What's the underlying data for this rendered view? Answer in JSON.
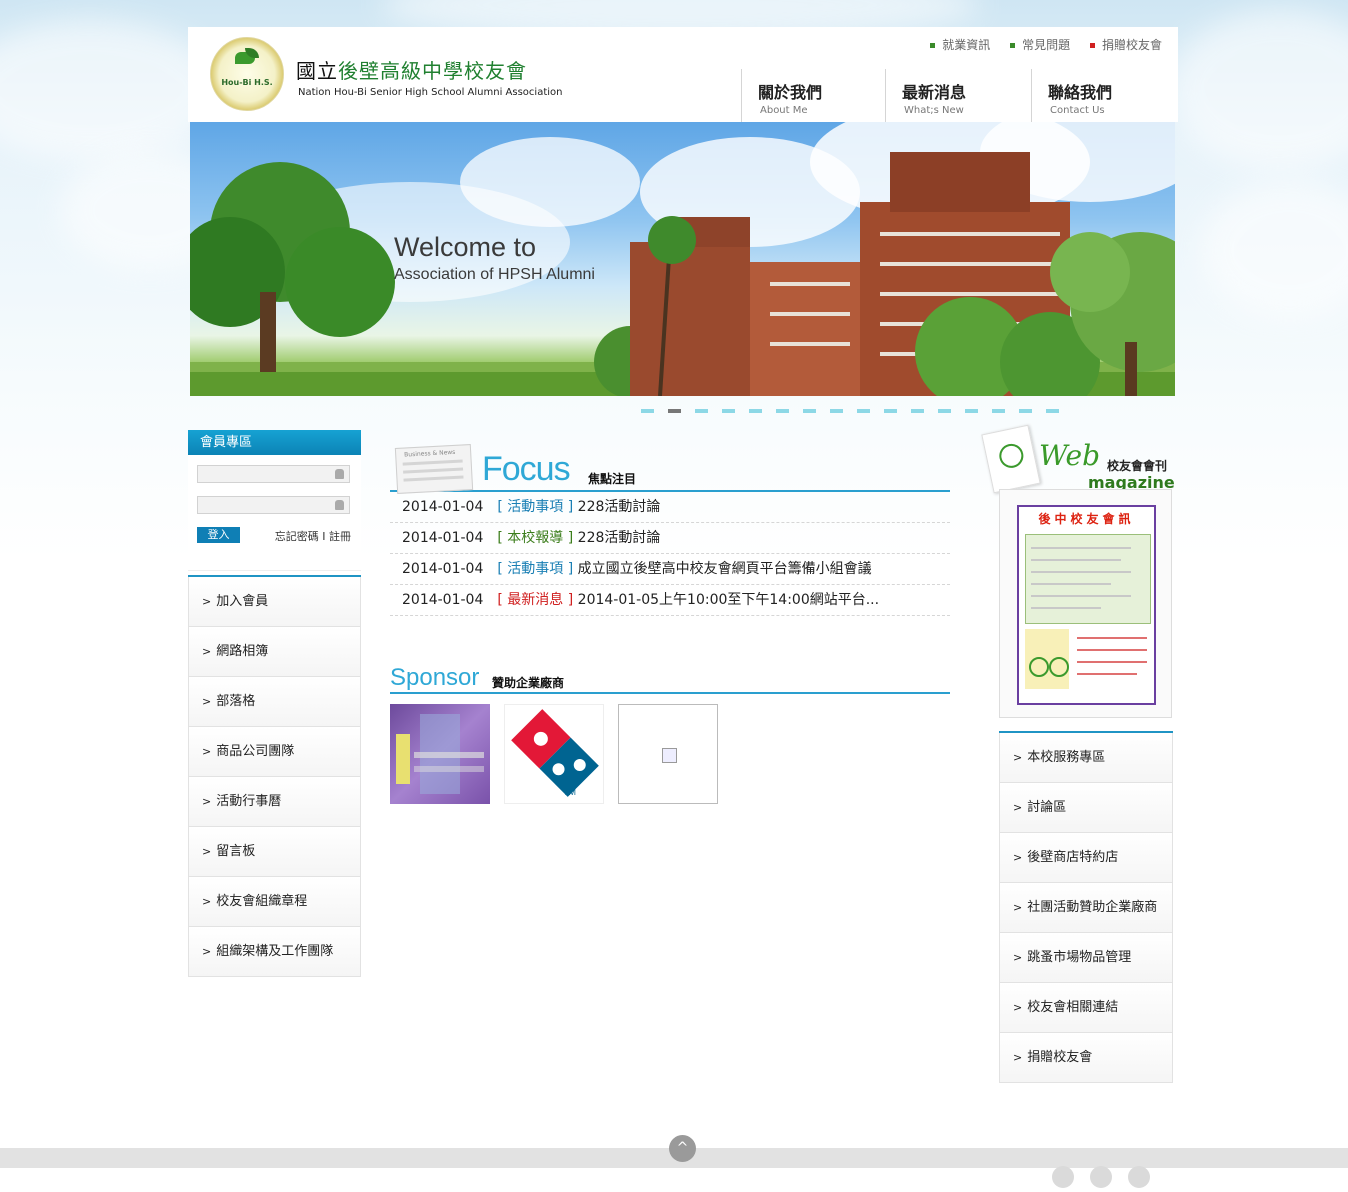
{
  "header": {
    "logo_text": "Hou-Bi H.S.",
    "title_prefix": "國立",
    "title_main": "後壁高級中學校友會",
    "subtitle": "Nation Hou-Bi Senior High School Alumni Association",
    "top_links": [
      {
        "label": "就業資訊",
        "color": "#3a8b2a"
      },
      {
        "label": "常見問題",
        "color": "#3a8b2a"
      },
      {
        "label": "捐贈校友會",
        "color": "#d02020"
      }
    ],
    "nav": [
      {
        "zh": "關於我們",
        "en": "About Me"
      },
      {
        "zh": "最新消息",
        "en": "What;s New"
      },
      {
        "zh": "聯絡我們",
        "en": "Contact Us"
      }
    ]
  },
  "banner": {
    "line1": "Welcome to",
    "line2": "Association of HPSH Alumni",
    "slide_count": 16,
    "active_slide": 2
  },
  "member": {
    "title": "會員專區",
    "login_button": "登入",
    "forgot": "忘記密碼",
    "separator": "I",
    "register": "註冊"
  },
  "left_menu": [
    "加入會員",
    "網路相簿",
    "部落格",
    "商品公司團隊",
    "活動行事曆",
    "留言板",
    "校友會組織章程",
    "組織架構及工作團隊"
  ],
  "focus": {
    "title_en": "Focus",
    "title_zh": "焦點注目",
    "paper_label": "Business & News",
    "items": [
      {
        "date": "2014-01-04",
        "category": "活動事項",
        "cat_color": "#1a7fb4",
        "title": "228活動討論"
      },
      {
        "date": "2014-01-04",
        "category": "本校報導",
        "cat_color": "#3b7d1b",
        "title": "228活動討論"
      },
      {
        "date": "2014-01-04",
        "category": "活動事項",
        "cat_color": "#1a7fb4",
        "title": "成立國立後壁高中校友會網頁平台籌備小組會議"
      },
      {
        "date": "2014-01-04",
        "category": "最新消息",
        "cat_color": "#d02020",
        "title": "2014-01-05上午10:00至下午14:00網站平台..."
      }
    ]
  },
  "sponsor": {
    "title_en": "Sponsor",
    "title_zh": "贊助企業廠商"
  },
  "magazine": {
    "web": "Web",
    "title_zh": "校友會會刊",
    "magazine": "magazine",
    "paper_title": "後中校友會訊"
  },
  "right_menu": [
    "本校服務專區",
    "討論區",
    "後壁商店特約店",
    "社團活動贊助企業廠商",
    "跳蚤市場物品管理",
    "校友會相關連結",
    "捐贈校友會"
  ],
  "footer": {
    "to_top": "^"
  }
}
